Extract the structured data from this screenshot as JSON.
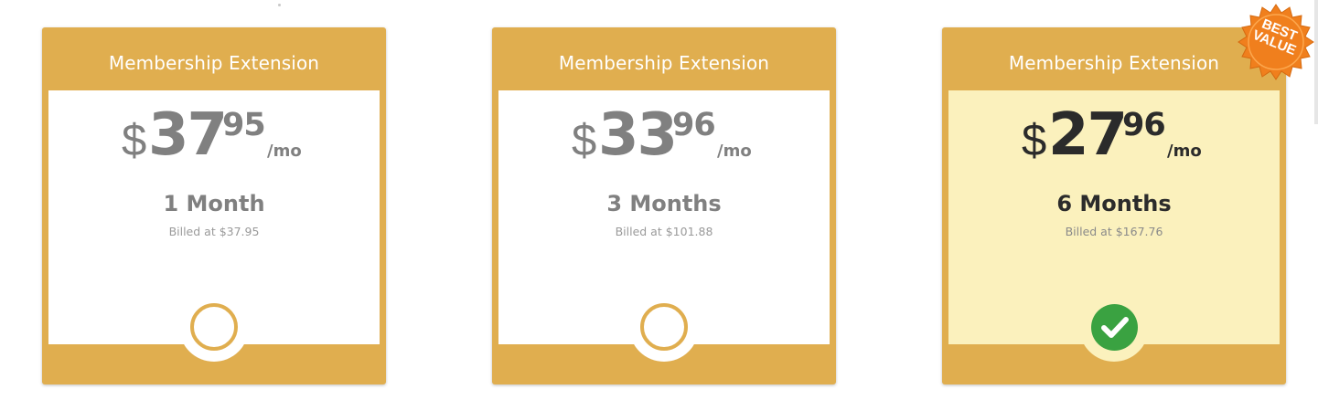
{
  "plans": [
    {
      "title": "Membership Extension",
      "currency": "$",
      "price_whole": "37",
      "price_cents": "95",
      "per_period": "/mo",
      "term": "1 Month",
      "billed": "Billed at $37.95",
      "selected": false
    },
    {
      "title": "Membership Extension",
      "currency": "$",
      "price_whole": "33",
      "price_cents": "96",
      "per_period": "/mo",
      "term": "3 Months",
      "billed": "Billed at $101.88",
      "selected": false
    },
    {
      "title": "Membership Extension",
      "currency": "$",
      "price_whole": "27",
      "price_cents": "96",
      "per_period": "/mo",
      "term": "6 Months",
      "billed": "Billed at $167.76",
      "selected": true
    }
  ],
  "badge": {
    "line1": "BEST",
    "line2": "VALUE",
    "color": "#f07f1d"
  },
  "colors": {
    "card": "#e0ae4f",
    "selected_body": "#fbf1bd",
    "check": "#3aa241",
    "muted_text": "#808080",
    "dark_text": "#2b2b2b"
  },
  "icons": {
    "unselected": "radio-circle-icon",
    "selected": "check-circle-icon",
    "badge": "starburst-badge-icon"
  }
}
